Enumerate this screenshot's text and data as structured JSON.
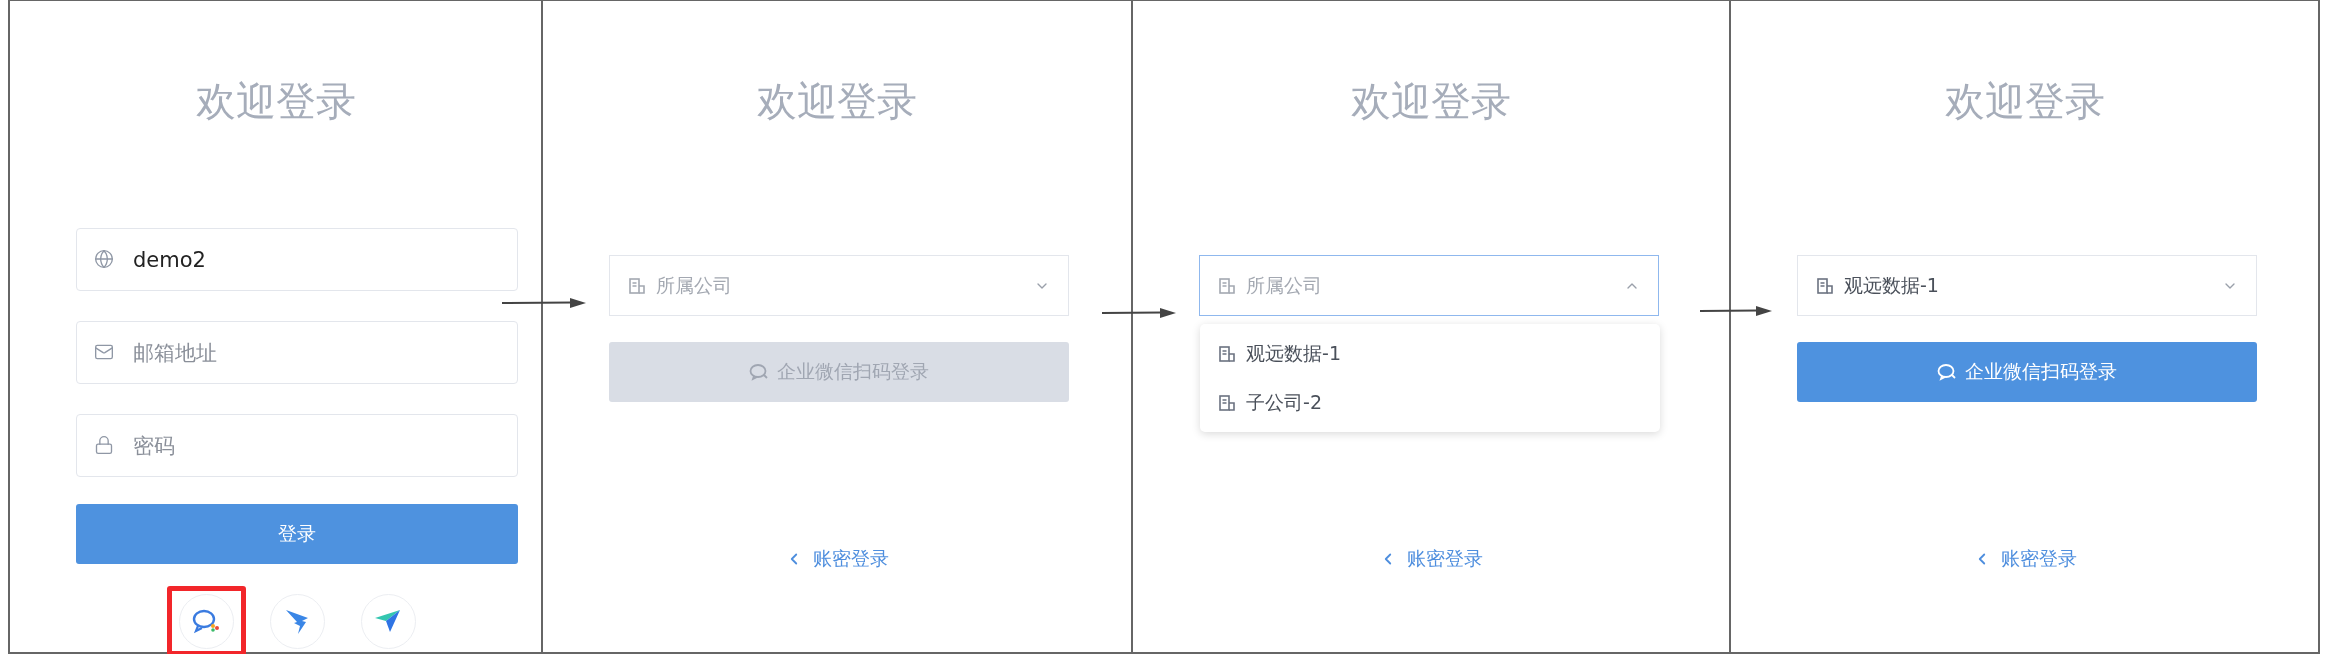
{
  "panels": [
    {
      "kind": "password",
      "title": "欢迎登录",
      "fields": [
        {
          "value": "demo2"
        },
        {
          "placeholder": "邮箱地址"
        },
        {
          "placeholder": "密码"
        }
      ],
      "submit": "登录",
      "social": [
        {
          "highlighted": true
        },
        {
          "highlighted": false
        },
        {
          "highlighted": false
        }
      ]
    },
    {
      "kind": "company",
      "title": "欢迎登录",
      "select": {
        "placeholder": "所属公司",
        "expanded": false
      },
      "button": {
        "label": "企业微信扫码登录",
        "disabled": true
      },
      "link": "账密登录"
    },
    {
      "kind": "company",
      "title": "欢迎登录",
      "select": {
        "placeholder": "所属公司",
        "expanded": true,
        "options": [
          "观远数据-1",
          "子公司-2"
        ]
      },
      "link": "账密登录"
    },
    {
      "kind": "company",
      "title": "欢迎登录",
      "select": {
        "value": "观远数据-1",
        "expanded": false
      },
      "button": {
        "label": "企业微信扫码登录",
        "disabled": false
      },
      "link": "账密登录"
    }
  ]
}
